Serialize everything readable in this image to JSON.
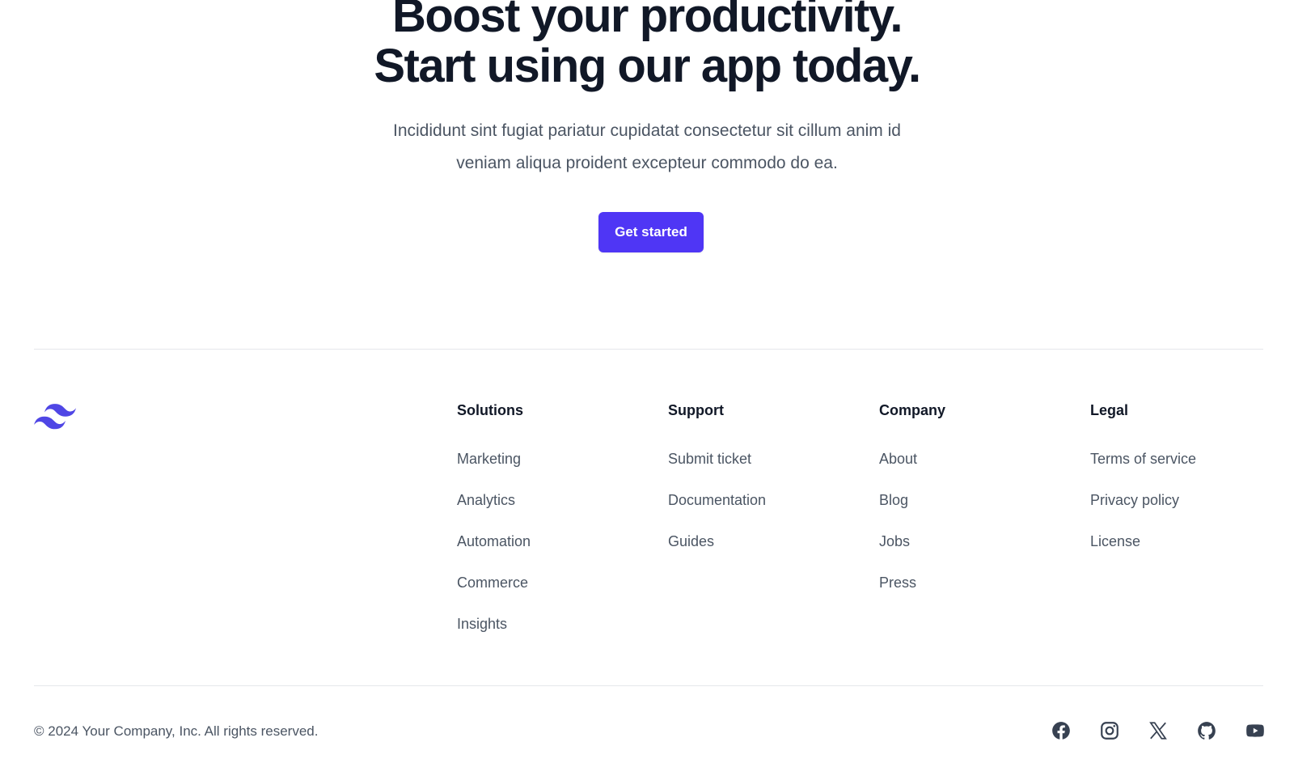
{
  "cta": {
    "headline_line1": "Boost your productivity.",
    "headline_line2": "Start using our app today.",
    "subtext_line1": "Incididunt sint fugiat pariatur cupidatat consectetur sit cillum anim id",
    "subtext_line2": "veniam aliqua proident excepteur commodo do ea.",
    "button_label": "Get started"
  },
  "colors": {
    "accent": "#4f36f5",
    "heading": "#111827",
    "body_text": "#4b5563",
    "divider": "#e5e7eb"
  },
  "footer": {
    "logo_icon": "tailwind-logo-icon",
    "columns": [
      {
        "heading": "Solutions",
        "links": [
          "Marketing",
          "Analytics",
          "Automation",
          "Commerce",
          "Insights"
        ]
      },
      {
        "heading": "Support",
        "links": [
          "Submit ticket",
          "Documentation",
          "Guides"
        ]
      },
      {
        "heading": "Company",
        "links": [
          "About",
          "Blog",
          "Jobs",
          "Press"
        ]
      },
      {
        "heading": "Legal",
        "links": [
          "Terms of service",
          "Privacy policy",
          "License"
        ]
      }
    ],
    "copyright": "© 2024 Your Company, Inc. All rights reserved.",
    "social_icons": [
      "facebook-icon",
      "instagram-icon",
      "x-icon",
      "github-icon",
      "youtube-icon"
    ]
  }
}
